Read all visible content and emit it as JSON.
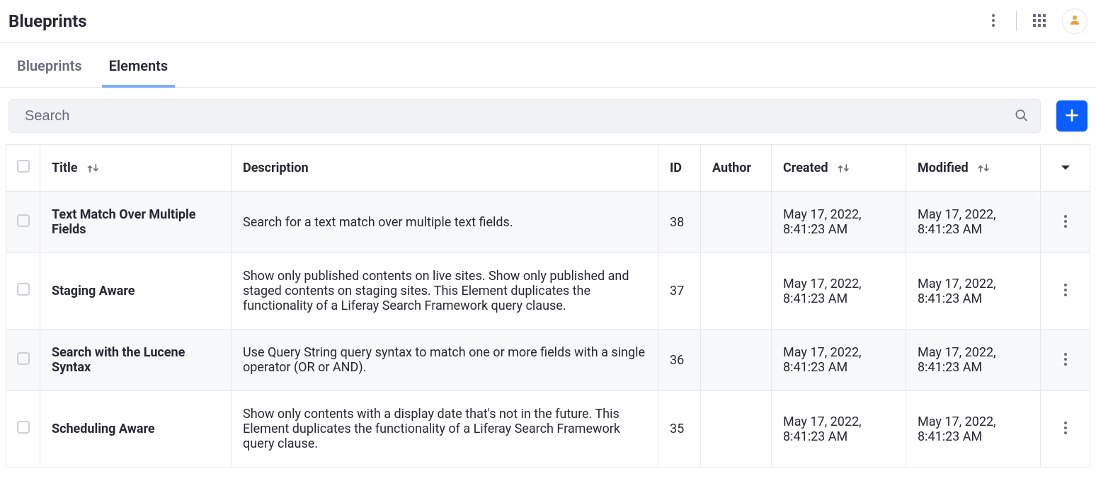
{
  "header": {
    "title": "Blueprints"
  },
  "tabs": [
    {
      "label": "Blueprints",
      "active": false
    },
    {
      "label": "Elements",
      "active": true
    }
  ],
  "search": {
    "placeholder": "Search",
    "value": ""
  },
  "table": {
    "columns": {
      "title": "Title",
      "description": "Description",
      "id": "ID",
      "author": "Author",
      "created": "Created",
      "modified": "Modified"
    },
    "rows": [
      {
        "title": "Text Match Over Multiple Fields",
        "description": "Search for a text match over multiple text fields.",
        "id": "38",
        "author": "",
        "created": "May 17, 2022, 8:41:23 AM",
        "modified": "May 17, 2022, 8:41:23 AM"
      },
      {
        "title": "Staging Aware",
        "description": "Show only published contents on live sites. Show only published and staged contents on staging sites. This Element duplicates the functionality of a Liferay Search Framework query clause.",
        "id": "37",
        "author": "",
        "created": "May 17, 2022, 8:41:23 AM",
        "modified": "May 17, 2022, 8:41:23 AM"
      },
      {
        "title": "Search with the Lucene Syntax",
        "description": "Use Query String query syntax to match one or more fields with a single operator (OR or AND).",
        "id": "36",
        "author": "",
        "created": "May 17, 2022, 8:41:23 AM",
        "modified": "May 17, 2022, 8:41:23 AM"
      },
      {
        "title": "Scheduling Aware",
        "description": "Show only contents with a display date that's not in the future. This Element duplicates the functionality of a Liferay Search Framework query clause.",
        "id": "35",
        "author": "",
        "created": "May 17, 2022, 8:41:23 AM",
        "modified": "May 17, 2022, 8:41:23 AM"
      }
    ]
  }
}
